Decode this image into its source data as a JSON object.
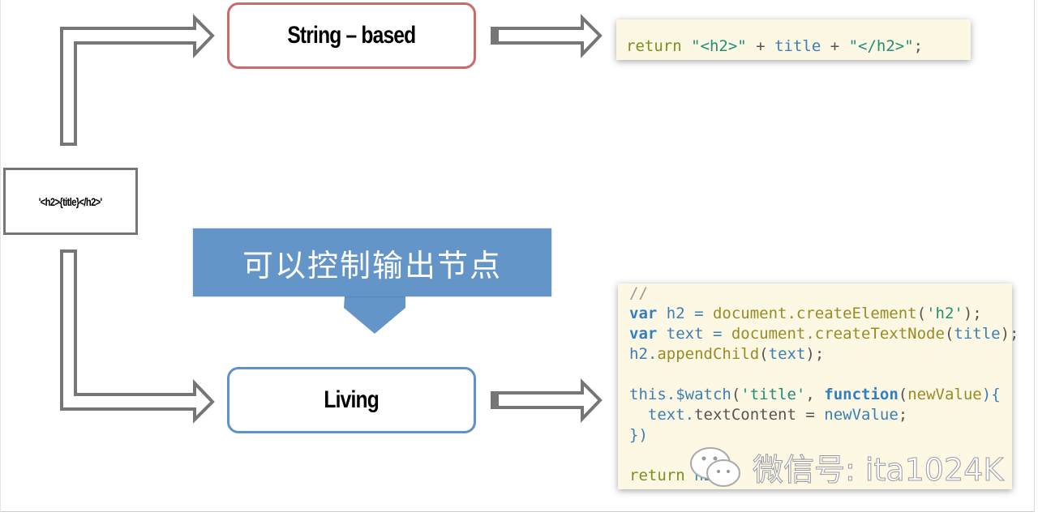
{
  "source_template": "'<h2>{title}</h2>'",
  "boxes": {
    "string_based": "String – based",
    "living": "Living"
  },
  "callout": "可以控制输出节点",
  "code_string": [
    [
      [
        "return",
        "ret"
      ],
      [
        " ",
        "pn"
      ],
      [
        "\"<h2>\"",
        "str"
      ],
      [
        " + ",
        "pn"
      ],
      [
        "title",
        "id"
      ],
      [
        " + ",
        "pn"
      ],
      [
        "\"</h2>\"",
        "str"
      ],
      [
        ";",
        "pn"
      ]
    ]
  ],
  "code_living": [
    [
      [
        "//",
        "cm"
      ]
    ],
    [
      [
        "var",
        "kw"
      ],
      [
        " h2 = ",
        "id"
      ],
      [
        "document.createElement",
        "fn"
      ],
      [
        "(",
        "pn"
      ],
      [
        "'h2'",
        "str"
      ],
      [
        ");",
        "pn"
      ]
    ],
    [
      [
        "var",
        "kw"
      ],
      [
        " text = ",
        "id"
      ],
      [
        "document.createTextNode",
        "fn"
      ],
      [
        "(",
        "pn"
      ],
      [
        "title",
        "id"
      ],
      [
        ");",
        "pn"
      ]
    ],
    [
      [
        "h2.",
        "id"
      ],
      [
        "appendChild",
        "fn"
      ],
      [
        "(",
        "pn"
      ],
      [
        "text",
        "id"
      ],
      [
        ");",
        "pn"
      ]
    ],
    [
      [
        "",
        "pn"
      ]
    ],
    [
      [
        "this.$watch",
        "id"
      ],
      [
        "(",
        "pn"
      ],
      [
        "'title'",
        "str"
      ],
      [
        ", ",
        "pn"
      ],
      [
        "function",
        "kw"
      ],
      [
        "(",
        "pn"
      ],
      [
        "newValue",
        "fn"
      ],
      [
        "){",
        "id"
      ]
    ],
    [
      [
        "  text.",
        "id"
      ],
      [
        "textContent",
        "pn"
      ],
      [
        " = ",
        "pn"
      ],
      [
        "newValue",
        "id"
      ],
      [
        ";",
        "pn"
      ]
    ],
    [
      [
        "})",
        "id"
      ]
    ],
    [
      [
        "",
        "pn"
      ]
    ],
    [
      [
        "return",
        "ret"
      ],
      [
        " h2;",
        "id"
      ]
    ]
  ],
  "watermark": "微信号: ita1024K",
  "colors": {
    "string_box_border": "#c96b69",
    "living_box_border": "#5f92c6",
    "callout_fill": "#6495c8",
    "code_background": "#fdf8e4",
    "arrow_stroke": "#767676"
  }
}
